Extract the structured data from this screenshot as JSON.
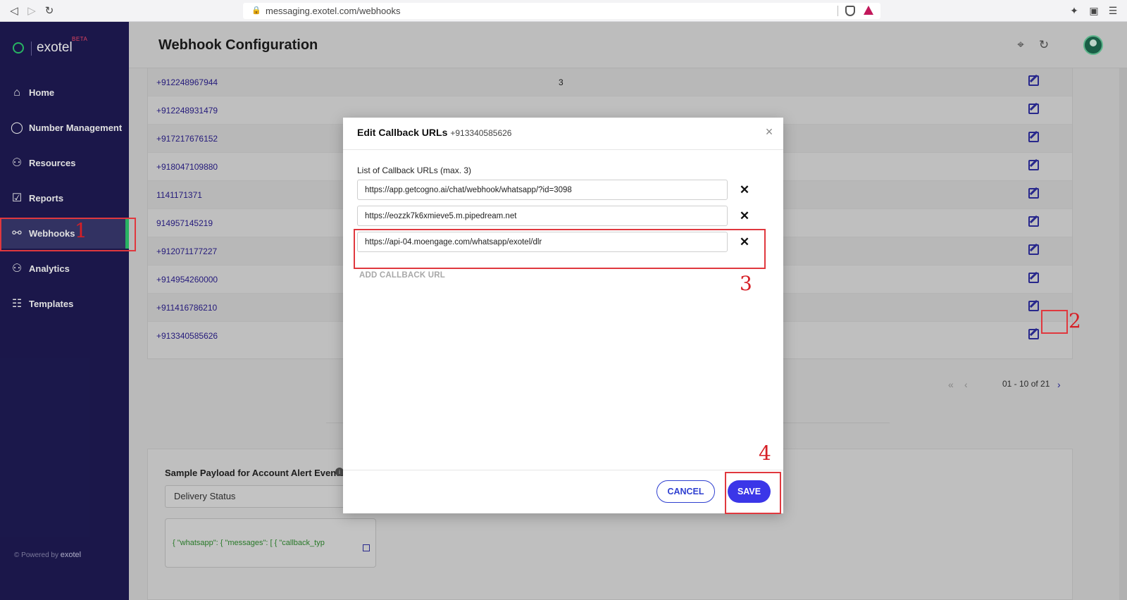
{
  "browser": {
    "url": "messaging.exotel.com/webhooks"
  },
  "sidebar": {
    "logo_text": "exotel",
    "logo_badge": "BETA",
    "items": [
      {
        "label": "Home",
        "icon": "home-icon"
      },
      {
        "label": "Number Management",
        "icon": "whatsapp-icon"
      },
      {
        "label": "Resources",
        "icon": "resources-icon"
      },
      {
        "label": "Reports",
        "icon": "reports-icon"
      },
      {
        "label": "Webhooks",
        "icon": "webhooks-icon",
        "active": true
      },
      {
        "label": "Analytics",
        "icon": "analytics-icon"
      },
      {
        "label": "Templates",
        "icon": "templates-icon"
      }
    ],
    "powered_by": "Powered by",
    "powered_brand": "exotel"
  },
  "header": {
    "title": "Webhook Configuration"
  },
  "table": {
    "rows": [
      {
        "number": "+912248967944",
        "count": "3"
      },
      {
        "number": "+912248931479",
        "count": ""
      },
      {
        "number": "+917217676152",
        "count": ""
      },
      {
        "number": "+918047109880",
        "count": ""
      },
      {
        "number": "1141171371",
        "count": ""
      },
      {
        "number": "914957145219",
        "count": ""
      },
      {
        "number": "+912071177227",
        "count": ""
      },
      {
        "number": "+914954260000",
        "count": ""
      },
      {
        "number": "+911416786210",
        "count": ""
      },
      {
        "number": "+913340585626",
        "count": ""
      }
    ]
  },
  "pagination": {
    "range": "01 - 10 of 21"
  },
  "payload": {
    "title": "Sample Payload for Account Alert Events",
    "selected": "Delivery Status",
    "code": "{  \"whatsapp\": {    \"messages\": [      {      \"callback_typ"
  },
  "modal": {
    "title": "Edit Callback URLs",
    "number": "+913340585626",
    "list_label": "List of Callback URLs (max. 3)",
    "urls": [
      "https://app.getcogno.ai/chat/webhook/whatsapp/?id=3098",
      "https://eozzk7k6xmieve5.m.pipedream.net",
      "https://api-04.moengage.com/whatsapp/exotel/dlr"
    ],
    "add_label": "ADD CALLBACK URL",
    "cancel_label": "CANCEL",
    "save_label": "SAVE"
  },
  "annotations": [
    "1",
    "2",
    "3",
    "4"
  ],
  "colors": {
    "sidebar_bg": "#1f1b55",
    "accent": "#3b36e8",
    "active_indicator": "#2ecc71",
    "annotation_red": "#e0383e"
  }
}
